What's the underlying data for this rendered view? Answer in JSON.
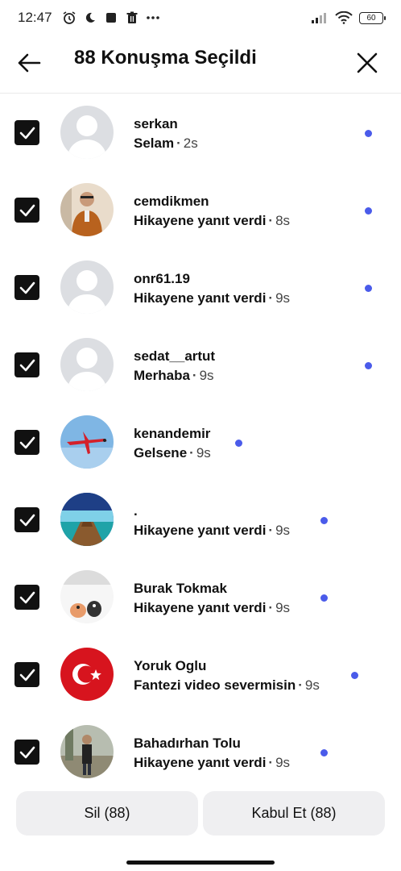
{
  "status_bar": {
    "time": "12:47",
    "battery": "60",
    "icons": [
      "alarm-icon",
      "moon-icon",
      "stop-icon",
      "trash-icon",
      "more-icon",
      "signal-icon",
      "wifi-icon",
      "battery-icon"
    ]
  },
  "header": {
    "title": "88 Konuşma Seçildi",
    "back_icon": "arrow-left-icon",
    "close_icon": "close-icon"
  },
  "conversations": [
    {
      "name": "serkan",
      "message": "Selam",
      "time": "2s",
      "unread": true,
      "checked": true,
      "avatar": "default"
    },
    {
      "name": "cemdikmen",
      "message": "Hikayene yanıt verdi",
      "time": "8s",
      "unread": true,
      "checked": true,
      "avatar": "photo-man-orange"
    },
    {
      "name": "onr61.19",
      "message": "Hikayene yanıt verdi",
      "time": "9s",
      "unread": true,
      "checked": true,
      "avatar": "default"
    },
    {
      "name": "sedat__artut",
      "message": "Merhaba",
      "time": "9s",
      "unread": true,
      "checked": true,
      "avatar": "default"
    },
    {
      "name": "kenandemir",
      "message": "Gelsene",
      "time": "9s",
      "unread": true,
      "checked": true,
      "avatar": "plane"
    },
    {
      "name": ".",
      "message": "Hikayene yanıt verdi",
      "time": "9s",
      "unread": true,
      "checked": true,
      "avatar": "pier"
    },
    {
      "name": "Burak Tokmak",
      "message": "Hikayene yanıt verdi",
      "time": "9s",
      "unread": true,
      "checked": true,
      "avatar": "cartoon"
    },
    {
      "name": "Yoruk Oglu",
      "message": "Fantezi video severmisin",
      "time": "9s",
      "unread": true,
      "checked": true,
      "avatar": "flag-tr"
    },
    {
      "name": "Bahadırhan Tolu",
      "message": "Hikayene yanıt verdi",
      "time": "9s",
      "unread": true,
      "checked": true,
      "avatar": "photo-man-outdoor"
    }
  ],
  "actions": {
    "delete_label": "Sil (88)",
    "accept_label": "Kabul Et (88)"
  },
  "colors": {
    "unread_dot": "#4a5bea",
    "checkbox": "#111111",
    "button_bg": "#efeff1"
  }
}
